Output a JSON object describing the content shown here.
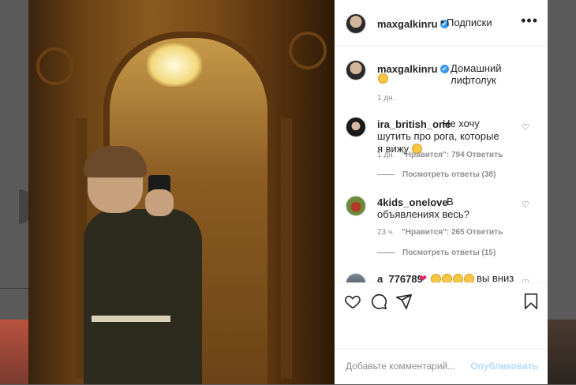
{
  "post": {
    "author": "maxgalkinru",
    "follow_separator": "•",
    "follow_label": "Подписки",
    "more_icon": "more-horizontal-icon",
    "verified_glyph": "✔"
  },
  "caption": {
    "author": "maxgalkinru",
    "text": "Домашний лифтолук",
    "emoji": "smiling-face-icon",
    "time": "1 дн."
  },
  "comments": [
    {
      "author": "ira_british_one",
      "text": "Не хочу шутить про рога, которые я вижу",
      "emoji": "grinning-face-icon",
      "time": "1 дн.",
      "likes": "\"Нравится\": 794",
      "reply": "Ответить",
      "view_replies": "Посмотреть ответы (38)"
    },
    {
      "author": "4kids_onelove",
      "text": "В объявлениях весь?",
      "time": "23 ч.",
      "likes": "\"Нравится\": 265",
      "reply": "Ответить",
      "view_replies": "Посмотреть ответы (15)"
    },
    {
      "author": "a_776789",
      "text": "вы вниз"
    }
  ],
  "actions": {
    "like_icon": "heart-icon",
    "comment_icon": "comment-icon",
    "share_icon": "share-icon",
    "save_icon": "bookmark-icon"
  },
  "add_comment": {
    "placeholder": "Добавьте комментарий...",
    "publish_label": "Опубликовать"
  },
  "colors": {
    "accent": "#3897f0",
    "publish_disabled": "#b3dbff",
    "secondary_text": "#8e8e8e",
    "primary_text": "#262626"
  }
}
